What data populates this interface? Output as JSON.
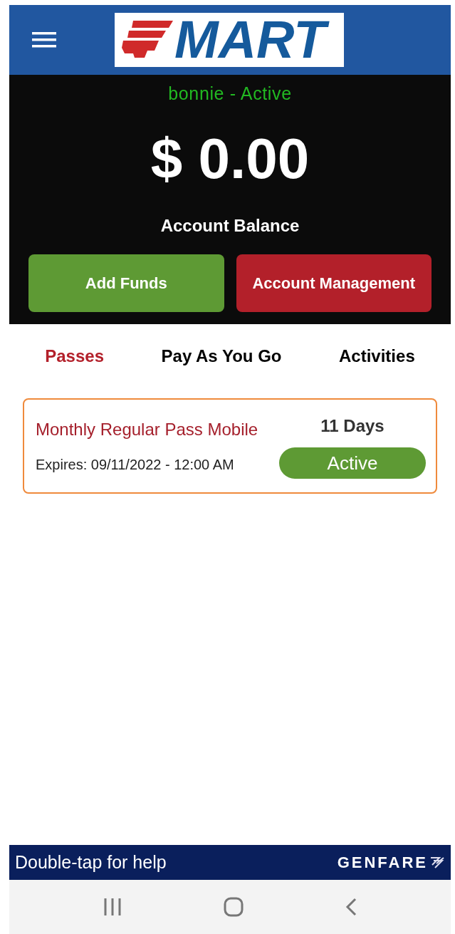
{
  "header": {
    "logo_text": "MART"
  },
  "account": {
    "status": "bonnie - Active",
    "balance": "$ 0.00",
    "balance_label": "Account Balance"
  },
  "buttons": [
    {
      "label": "Add Funds",
      "kind": "positive"
    },
    {
      "label": "Account Management",
      "kind": "danger"
    }
  ],
  "tabs": [
    {
      "label": "Passes",
      "selected": true
    },
    {
      "label": "Pay As You Go",
      "selected": false
    },
    {
      "label": "Activities",
      "selected": false
    }
  ],
  "passes": [
    {
      "name": "Monthly Regular Pass Mobile",
      "expires": "Expires: 09/11/2022 - 12:00 AM",
      "remaining": "11 Days",
      "status": "Active"
    }
  ],
  "footer": {
    "help": "Double-tap for help",
    "brand": "GENFARE"
  }
}
